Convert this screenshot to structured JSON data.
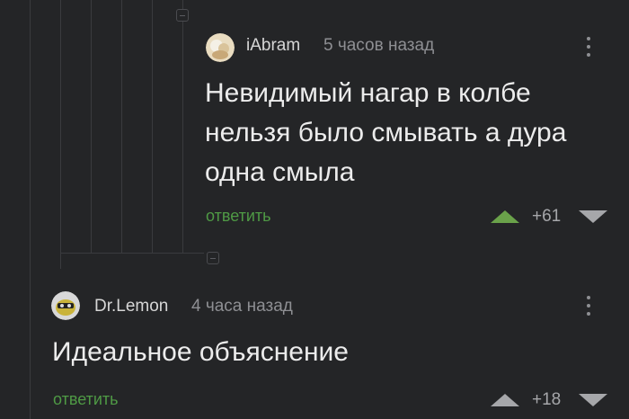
{
  "comments": [
    {
      "author": "iAbram",
      "time": "5 часов назад",
      "text": "Невидимый нагар в колбе нельзя было смывать а дура одна смыла",
      "reply_label": "ответить",
      "rating": "+61",
      "upvoted": true
    },
    {
      "author": "Dr.Lemon",
      "time": "4 часа назад",
      "text": "Идеальное объяснение",
      "reply_label": "ответить",
      "rating": "+18",
      "upvoted": false
    }
  ],
  "colors": {
    "background": "#242527",
    "accent_green": "#4f9a45",
    "upvote_active": "#6aa24a",
    "muted": "#8e8f93"
  },
  "icons": [
    "collapse-icon",
    "more-icon",
    "upvote-icon",
    "downvote-icon"
  ]
}
